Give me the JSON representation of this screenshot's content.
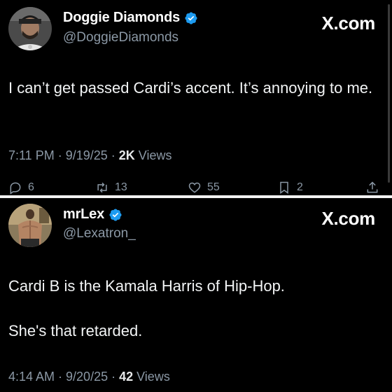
{
  "tweets": [
    {
      "display_name": "Doggie Diamonds",
      "handle": "@DoggieDiamonds",
      "brand": "X.com",
      "text": "I can’t get passed Cardi’s accent. It’s annoying to me.",
      "time_date": "7:11 PM · 9/19/25 · ",
      "views_count": "2K",
      "views_label": " Views",
      "actions": {
        "replies": "6",
        "reposts": "13",
        "likes": "55",
        "bookmarks": "2"
      }
    },
    {
      "display_name": "mrLex",
      "handle": "@Lexatron_",
      "brand": "X.com",
      "text_line1": "Cardi B is the Kamala Harris of Hip-Hop.",
      "text_line2": "She's that retarded.",
      "time_date": "4:14 AM · 9/20/25 · ",
      "views_count": "42",
      "views_label": " Views"
    }
  ],
  "colors": {
    "background": "#000000",
    "verified": "#1d9bf0",
    "secondary_text": "#8b98a5",
    "separator": "#f2f2f2"
  },
  "icons": [
    "verified-badge-icon",
    "reply-icon",
    "repost-icon",
    "like-icon",
    "bookmark-icon",
    "share-icon"
  ]
}
